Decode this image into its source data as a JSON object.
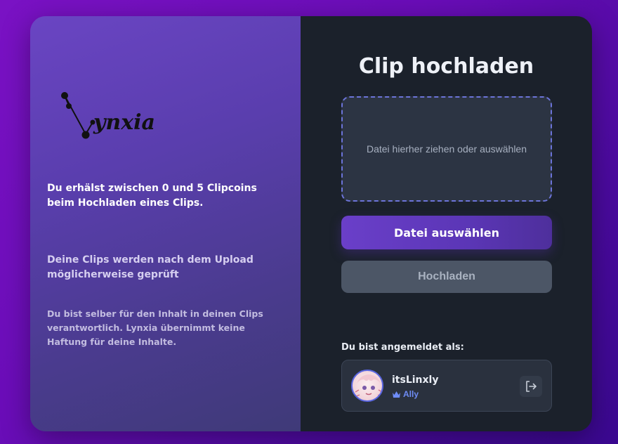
{
  "left_panel": {
    "logo_text": "ynxia",
    "info_coins": {
      "part1": "Du erhälst zwischen ",
      "min": "0",
      "part2": " und ",
      "max": "5",
      "part3": " Clipcoins beim Hochladen eines Clips."
    },
    "info_review": "Deine Clips werden nach dem Upload möglicherweise geprüft",
    "info_responsibility": "Du bist selber für den Inhalt in deinen Clips verantwortlich. Lynxia übernimmt keine Haftung für deine Inhalte."
  },
  "upload": {
    "title": "Clip hochladen",
    "dropzone_text": "Datei hierher ziehen oder auswählen",
    "select_button": "Datei auswählen",
    "upload_button": "Hochladen"
  },
  "account": {
    "label": "Du bist angemeldet als:",
    "username": "itsLinxly",
    "role": "Ally",
    "role_icon": "crown-icon",
    "logout_icon": "logout-icon"
  },
  "colors": {
    "accent": "#6a3fc9",
    "role": "#6e8cf6",
    "panel_dark": "#1b212b"
  }
}
